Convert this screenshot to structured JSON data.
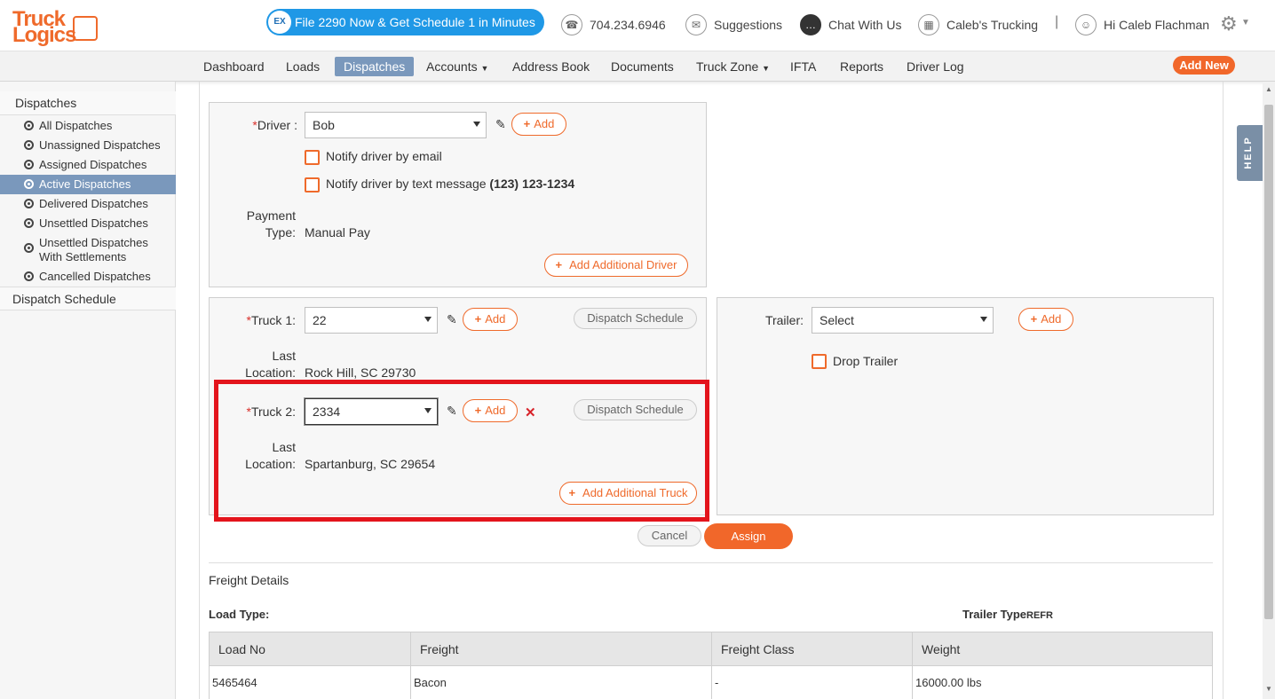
{
  "brand": {
    "logo_line1": "Truck",
    "logo_line2": "Logics",
    "accent": "#ef6a2b"
  },
  "header": {
    "promo_badge": "EX",
    "promo_text": "File 2290 Now & Get Schedule 1 in Minutes",
    "phone": "704.234.6946",
    "suggestions": "Suggestions",
    "chat": "Chat With Us",
    "company": "Caleb's Trucking",
    "separator": "|",
    "greeting": "Hi Caleb Flachman"
  },
  "nav": {
    "items": [
      "Dashboard",
      "Loads",
      "Dispatches",
      "Accounts",
      "Address Book",
      "Documents",
      "Truck Zone",
      "IFTA",
      "Reports",
      "Driver Log"
    ],
    "active": "Dispatches",
    "add_new": "Add New"
  },
  "sidebar": {
    "heading": "Dispatches",
    "items": [
      "All Dispatches",
      "Unassigned Dispatches",
      "Assigned Dispatches",
      "Active Dispatches",
      "Delivered Dispatches",
      "Unsettled Dispatches",
      "Unsettled Dispatches With Settlements",
      "Cancelled Dispatches"
    ],
    "active": "Active Dispatches",
    "footer": "Dispatch Schedule"
  },
  "driver": {
    "label": "Driver :",
    "value": "Bob",
    "add": "Add",
    "notify_email": "Notify driver by email",
    "notify_text": "Notify driver by text message",
    "notify_phone": "(123) 123-1234",
    "payment_label_1": "Payment",
    "payment_label_2": "Type:",
    "payment_value": "Manual Pay",
    "add_additional": "Add Additional Driver"
  },
  "truck1": {
    "label": "Truck 1:",
    "value": "22",
    "add": "Add",
    "schedule": "Dispatch Schedule",
    "last_label_1": "Last",
    "last_label_2": "Location:",
    "last_value": "Rock Hill, SC 29730"
  },
  "truck2": {
    "label": "Truck 2:",
    "value": "2334",
    "add": "Add",
    "remove": "✕",
    "schedule": "Dispatch Schedule",
    "last_label_1": "Last",
    "last_label_2": "Location:",
    "last_value": "Spartanburg, SC 29654",
    "add_additional": "Add Additional Truck"
  },
  "trailer": {
    "label": "Trailer:",
    "value": "Select",
    "add": "Add",
    "drop": "Drop Trailer"
  },
  "actions": {
    "cancel": "Cancel",
    "assign": "Assign"
  },
  "freight": {
    "title": "Freight Details",
    "load_type_label": "Load Type:",
    "trailer_type_label": "Trailer Type",
    "trailer_type_value": "REFR",
    "columns": [
      "Load No",
      "Freight",
      "Freight Class",
      "Weight"
    ],
    "rows": [
      [
        "5465464",
        "Bacon",
        "-",
        "16000.00 lbs"
      ]
    ]
  },
  "help": "HELP"
}
